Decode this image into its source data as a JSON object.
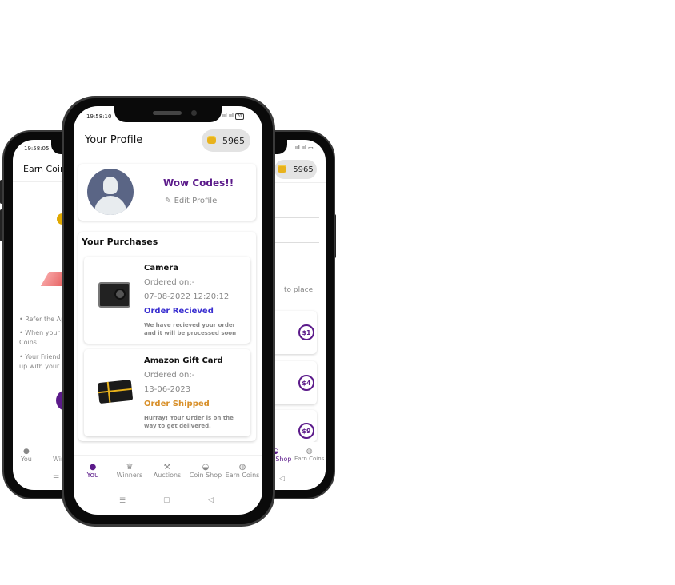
{
  "left_phone": {
    "time": "19:58:05",
    "title": "Earn Coins",
    "bullets": [
      "• Refer the App",
      "• When your friend",
      "Coins",
      "• Your Friend",
      "up with your"
    ],
    "nav": [
      "You",
      "Winners"
    ]
  },
  "right_phone": {
    "coins": "5965",
    "hint": "to place",
    "prices": [
      "$1",
      "$4",
      "$9"
    ],
    "nav": [
      "Coin Shop",
      "Earn Coins"
    ]
  },
  "front_phone": {
    "time": "19:58:10",
    "battery": "70",
    "header": {
      "title": "Your Profile",
      "coins": "5965"
    },
    "profile": {
      "name": "Wow Codes!!",
      "edit_label": "Edit Profile"
    },
    "purchases": {
      "title": "Your Purchases",
      "items": [
        {
          "name": "Camera",
          "ordered_label": "Ordered on:-",
          "date": "07-08-2022 12:20:12",
          "status": "Order Recieved",
          "status_color": "#3a2fd0",
          "message": "We have recieved your order and it will be processed soon"
        },
        {
          "name": "Amazon Gift Card",
          "ordered_label": "Ordered on:-",
          "date": "13-06-2023",
          "status": "Order Shipped",
          "status_color": "#d8902a",
          "message": "Hurray! Your Order is on the way to get delivered."
        }
      ]
    },
    "nav": [
      {
        "label": "You",
        "icon": "person-icon",
        "active": true
      },
      {
        "label": "Winners",
        "icon": "trophy-icon"
      },
      {
        "label": "Auctions",
        "icon": "gavel-icon"
      },
      {
        "label": "Coin Shop",
        "icon": "basket-icon"
      },
      {
        "label": "Earn Coins",
        "icon": "globe-icon"
      }
    ],
    "system_nav": {
      "menu": "☰",
      "home": "▢",
      "back": "◁"
    }
  },
  "colors": {
    "accent": "#5b1a8a",
    "avatar": "#5a6585"
  }
}
